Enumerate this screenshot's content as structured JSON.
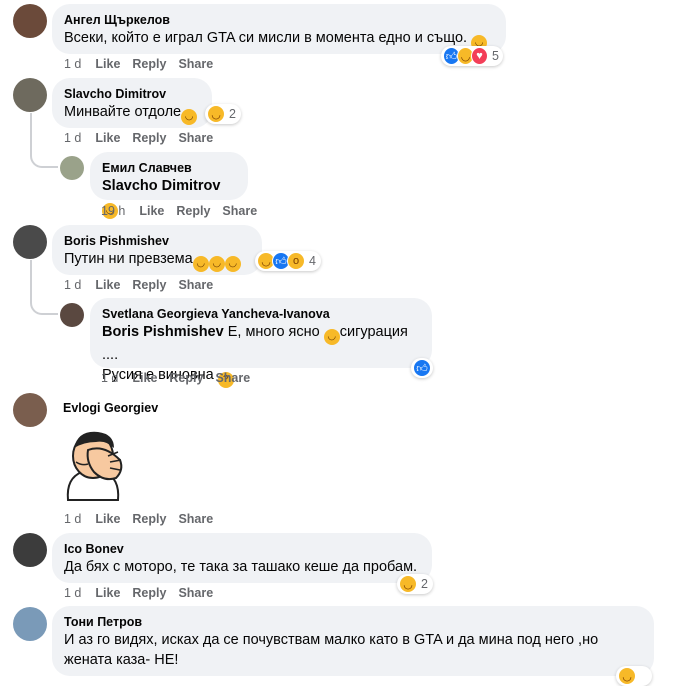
{
  "comments": [
    {
      "author": "Ангел Щъркелов",
      "text": "Всеки, който е играл GTA си мисли в момента едно и също.",
      "time": "1 d",
      "reaction_count": "5",
      "reaction_icons": [
        "like-icon",
        "haha-icon",
        "love-icon"
      ]
    },
    {
      "author": "Slavcho Dimitrov",
      "text": "Минвайте отдоле",
      "time": "1 d",
      "reaction_count": "2",
      "reaction_icons": [
        "haha-icon"
      ]
    },
    {
      "author": "Емил Славчев",
      "mention": "Slavcho Dimitrov",
      "text": "",
      "time": "19 h",
      "reply": true
    },
    {
      "author": "Boris Pishmishev",
      "text": "Путин ни превзема",
      "time": "1 d",
      "reaction_count": "4",
      "reaction_icons": [
        "haha-icon",
        "like-icon",
        "wow-icon"
      ]
    },
    {
      "author": "Svetlana Georgieva Yancheva-Ivanova",
      "mention": "Boris Pishmishev",
      "text": " Е, много ясно ",
      "text_tail": "сигурация ....",
      "text_line2": "Русия е виновна",
      "time": "1 d",
      "reply": true,
      "reaction_icons": [
        "like-icon"
      ]
    },
    {
      "author": "Evlogi Georgiev",
      "text": "",
      "time": "1 d",
      "sticker": "facepalm-sticker"
    },
    {
      "author": "Ico Bonev",
      "text": "Да бях с моторо, те така за ташако кеше да пробам.",
      "time": "1 d",
      "reaction_count": "2",
      "reaction_icons": [
        "haha-icon"
      ]
    },
    {
      "author": "Тони Петров",
      "text": "И аз го видях, исках да се почувствам малко като в GTA и да мина под него ,но",
      "text_line2": "жената каза- НЕ!"
    }
  ],
  "labels": {
    "like": "Like",
    "reply": "Reply",
    "share": "Share"
  },
  "colors": {
    "bubble": "#f0f2f5",
    "meta": "#65676b",
    "like_blue": "#1877f2",
    "haha_yellow": "#f7b928",
    "love_red": "#f33e58"
  }
}
